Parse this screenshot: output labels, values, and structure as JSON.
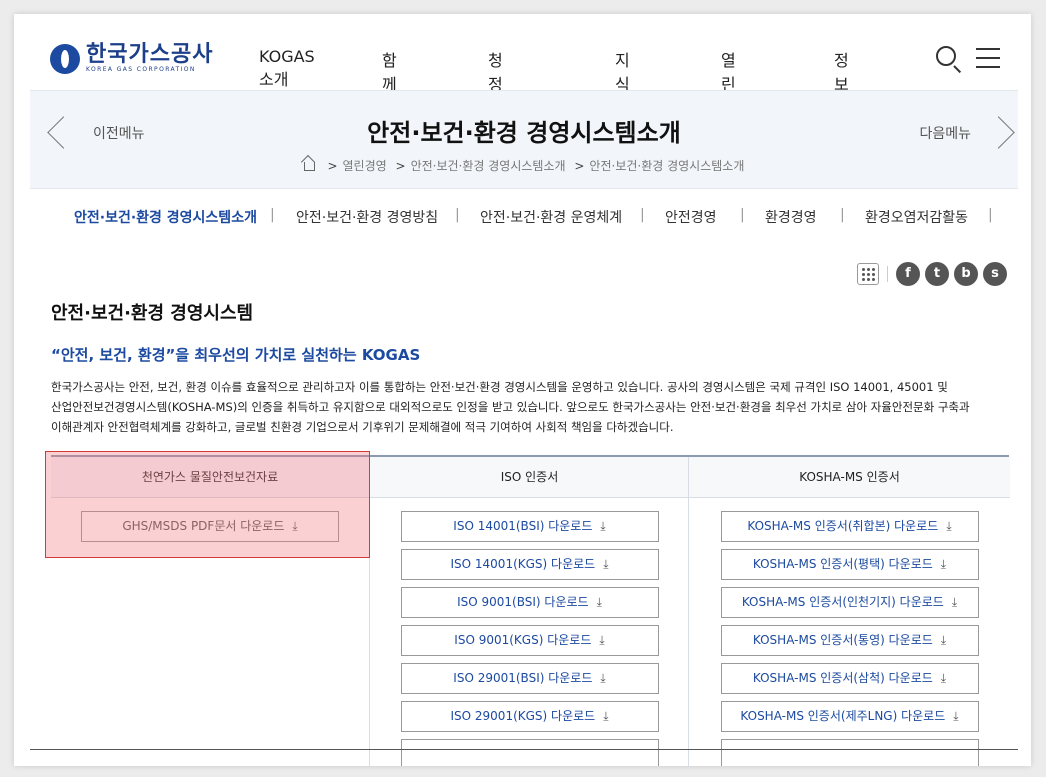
{
  "logo": {
    "ko": "한국가스공사",
    "en": "KOREA GAS CORPORATION"
  },
  "gnb": [
    "KOGAS소개",
    "함께해요",
    "청정에너지",
    "지식IN",
    "열린경영",
    "정보공개"
  ],
  "subvisual": {
    "prev_label": "이전메뉴",
    "next_label": "다음메뉴",
    "title": "안전·보건·환경 경영시스템소개",
    "breadcrumb": [
      "열린경영",
      "안전·보건·환경 경영시스템소개",
      "안전·보건·환경 경영시스템소개"
    ]
  },
  "tabs": [
    "안전·보건·환경 경영시스템소개",
    "안전·보건·환경 경영방침",
    "안전·보건·환경 운영체계",
    "안전경영",
    "환경경영",
    "환경오염저감활동"
  ],
  "share": {
    "sns": [
      "f",
      "t",
      "b",
      "s"
    ]
  },
  "content": {
    "heading": "안전·보건·환경 경영시스템",
    "lead": "“안전, 보건, 환경”을 최우선의 가치로 실천하는 KOGAS",
    "desc_lines": [
      "한국가스공사는 안전, 보건, 환경 이슈를 효율적으로 관리하고자 이를 통합하는 안전·보건·환경 경영시스템을 운영하고 있습니다. 공사의 경영시스템은 국제 규격인 ISO 14001, 45001 및",
      "산업안전보건경영시스템(KOSHA-MS)의 인증을 취득하고 유지함으로 대외적으로도 인정을 받고 있습니다. 앞으로도 한국가스공사는 안전·보건·환경을 최우선 가치로 삼아 자율안전문화 구축과",
      "이해관계자 안전협력체계를 강화하고, 글로벌 친환경 기업으로서 기후위기 문제해결에 적극 기여하여 사회적 책임을 다하겠습니다."
    ]
  },
  "table": {
    "headers": [
      "천연가스 물질안전보건자료",
      "ISO 인증서",
      "KOSHA-MS 인증서"
    ],
    "col1": [
      "GHS/MSDS PDF문서 다운로드"
    ],
    "col2": [
      "ISO 14001(BSI) 다운로드",
      "ISO 14001(KGS) 다운로드",
      "ISO 9001(BSI) 다운로드",
      "ISO 9001(KGS) 다운로드",
      "ISO 29001(BSI) 다운로드",
      "ISO 29001(KGS) 다운로드"
    ],
    "col3": [
      "KOSHA-MS 인증서(취합본) 다운로드",
      "KOSHA-MS 인증서(평택) 다운로드",
      "KOSHA-MS 인증서(인천기지) 다운로드",
      "KOSHA-MS 인증서(통영) 다운로드",
      "KOSHA-MS 인증서(삼척) 다운로드",
      "KOSHA-MS 인증서(제주LNG) 다운로드"
    ],
    "download_icon": "download-arrow-icon"
  },
  "colors": {
    "brand": "#1c4aa0",
    "highlight": "#d43a3a"
  }
}
